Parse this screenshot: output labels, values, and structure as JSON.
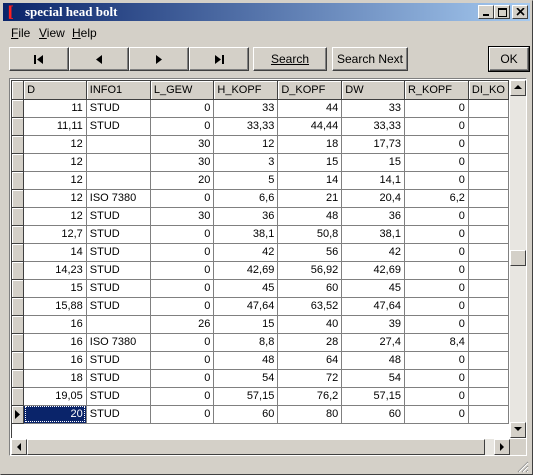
{
  "window": {
    "title": "special head bolt"
  },
  "menu": [
    {
      "label": "File",
      "mnemonic": "F",
      "rest": "ile"
    },
    {
      "label": "View",
      "mnemonic": "V",
      "rest": "iew"
    },
    {
      "label": "Help",
      "mnemonic": "H",
      "rest": "elp"
    }
  ],
  "toolbar": {
    "first_icon": "first-record-icon",
    "prev_icon": "previous-record-icon",
    "next_icon": "next-record-icon",
    "last_icon": "last-record-icon",
    "search_label": "Search",
    "search_next_label": "Search Next",
    "ok_label": "OK"
  },
  "table": {
    "columns": [
      "D",
      "INFO1",
      "L_GEW",
      "H_KOPF",
      "D_KOPF",
      "DW",
      "R_KOPF",
      "DI_KO"
    ],
    "rows": [
      [
        "11",
        "STUD",
        "0",
        "33",
        "44",
        "33",
        "0",
        ""
      ],
      [
        "11,11",
        "STUD",
        "0",
        "33,33",
        "44,44",
        "33,33",
        "0",
        ""
      ],
      [
        "12",
        "",
        "30",
        "12",
        "18",
        "17,73",
        "0",
        ""
      ],
      [
        "12",
        "",
        "30",
        "3",
        "15",
        "15",
        "0",
        ""
      ],
      [
        "12",
        "",
        "20",
        "5",
        "14",
        "14,1",
        "0",
        ""
      ],
      [
        "12",
        "ISO 7380",
        "0",
        "6,6",
        "21",
        "20,4",
        "6,2",
        ""
      ],
      [
        "12",
        "STUD",
        "30",
        "36",
        "48",
        "36",
        "0",
        ""
      ],
      [
        "12,7",
        "STUD",
        "0",
        "38,1",
        "50,8",
        "38,1",
        "0",
        ""
      ],
      [
        "14",
        "STUD",
        "0",
        "42",
        "56",
        "42",
        "0",
        ""
      ],
      [
        "14,23",
        "STUD",
        "0",
        "42,69",
        "56,92",
        "42,69",
        "0",
        ""
      ],
      [
        "15",
        "STUD",
        "0",
        "45",
        "60",
        "45",
        "0",
        ""
      ],
      [
        "15,88",
        "STUD",
        "0",
        "47,64",
        "63,52",
        "47,64",
        "0",
        ""
      ],
      [
        "16",
        "",
        "26",
        "15",
        "40",
        "39",
        "0",
        ""
      ],
      [
        "16",
        "ISO 7380",
        "0",
        "8,8",
        "28",
        "27,4",
        "8,4",
        ""
      ],
      [
        "16",
        "STUD",
        "0",
        "48",
        "64",
        "48",
        "0",
        ""
      ],
      [
        "18",
        "STUD",
        "0",
        "54",
        "72",
        "54",
        "0",
        ""
      ],
      [
        "19,05",
        "STUD",
        "0",
        "57,15",
        "76,2",
        "57,15",
        "0",
        ""
      ],
      [
        "20",
        "STUD",
        "0",
        "60",
        "80",
        "60",
        "0",
        ""
      ]
    ],
    "current_row": 17
  },
  "colors": {
    "title_start": "#0a246a",
    "title_end": "#a6caf0",
    "selection": "#0a246a",
    "face": "#d4d0c8"
  }
}
